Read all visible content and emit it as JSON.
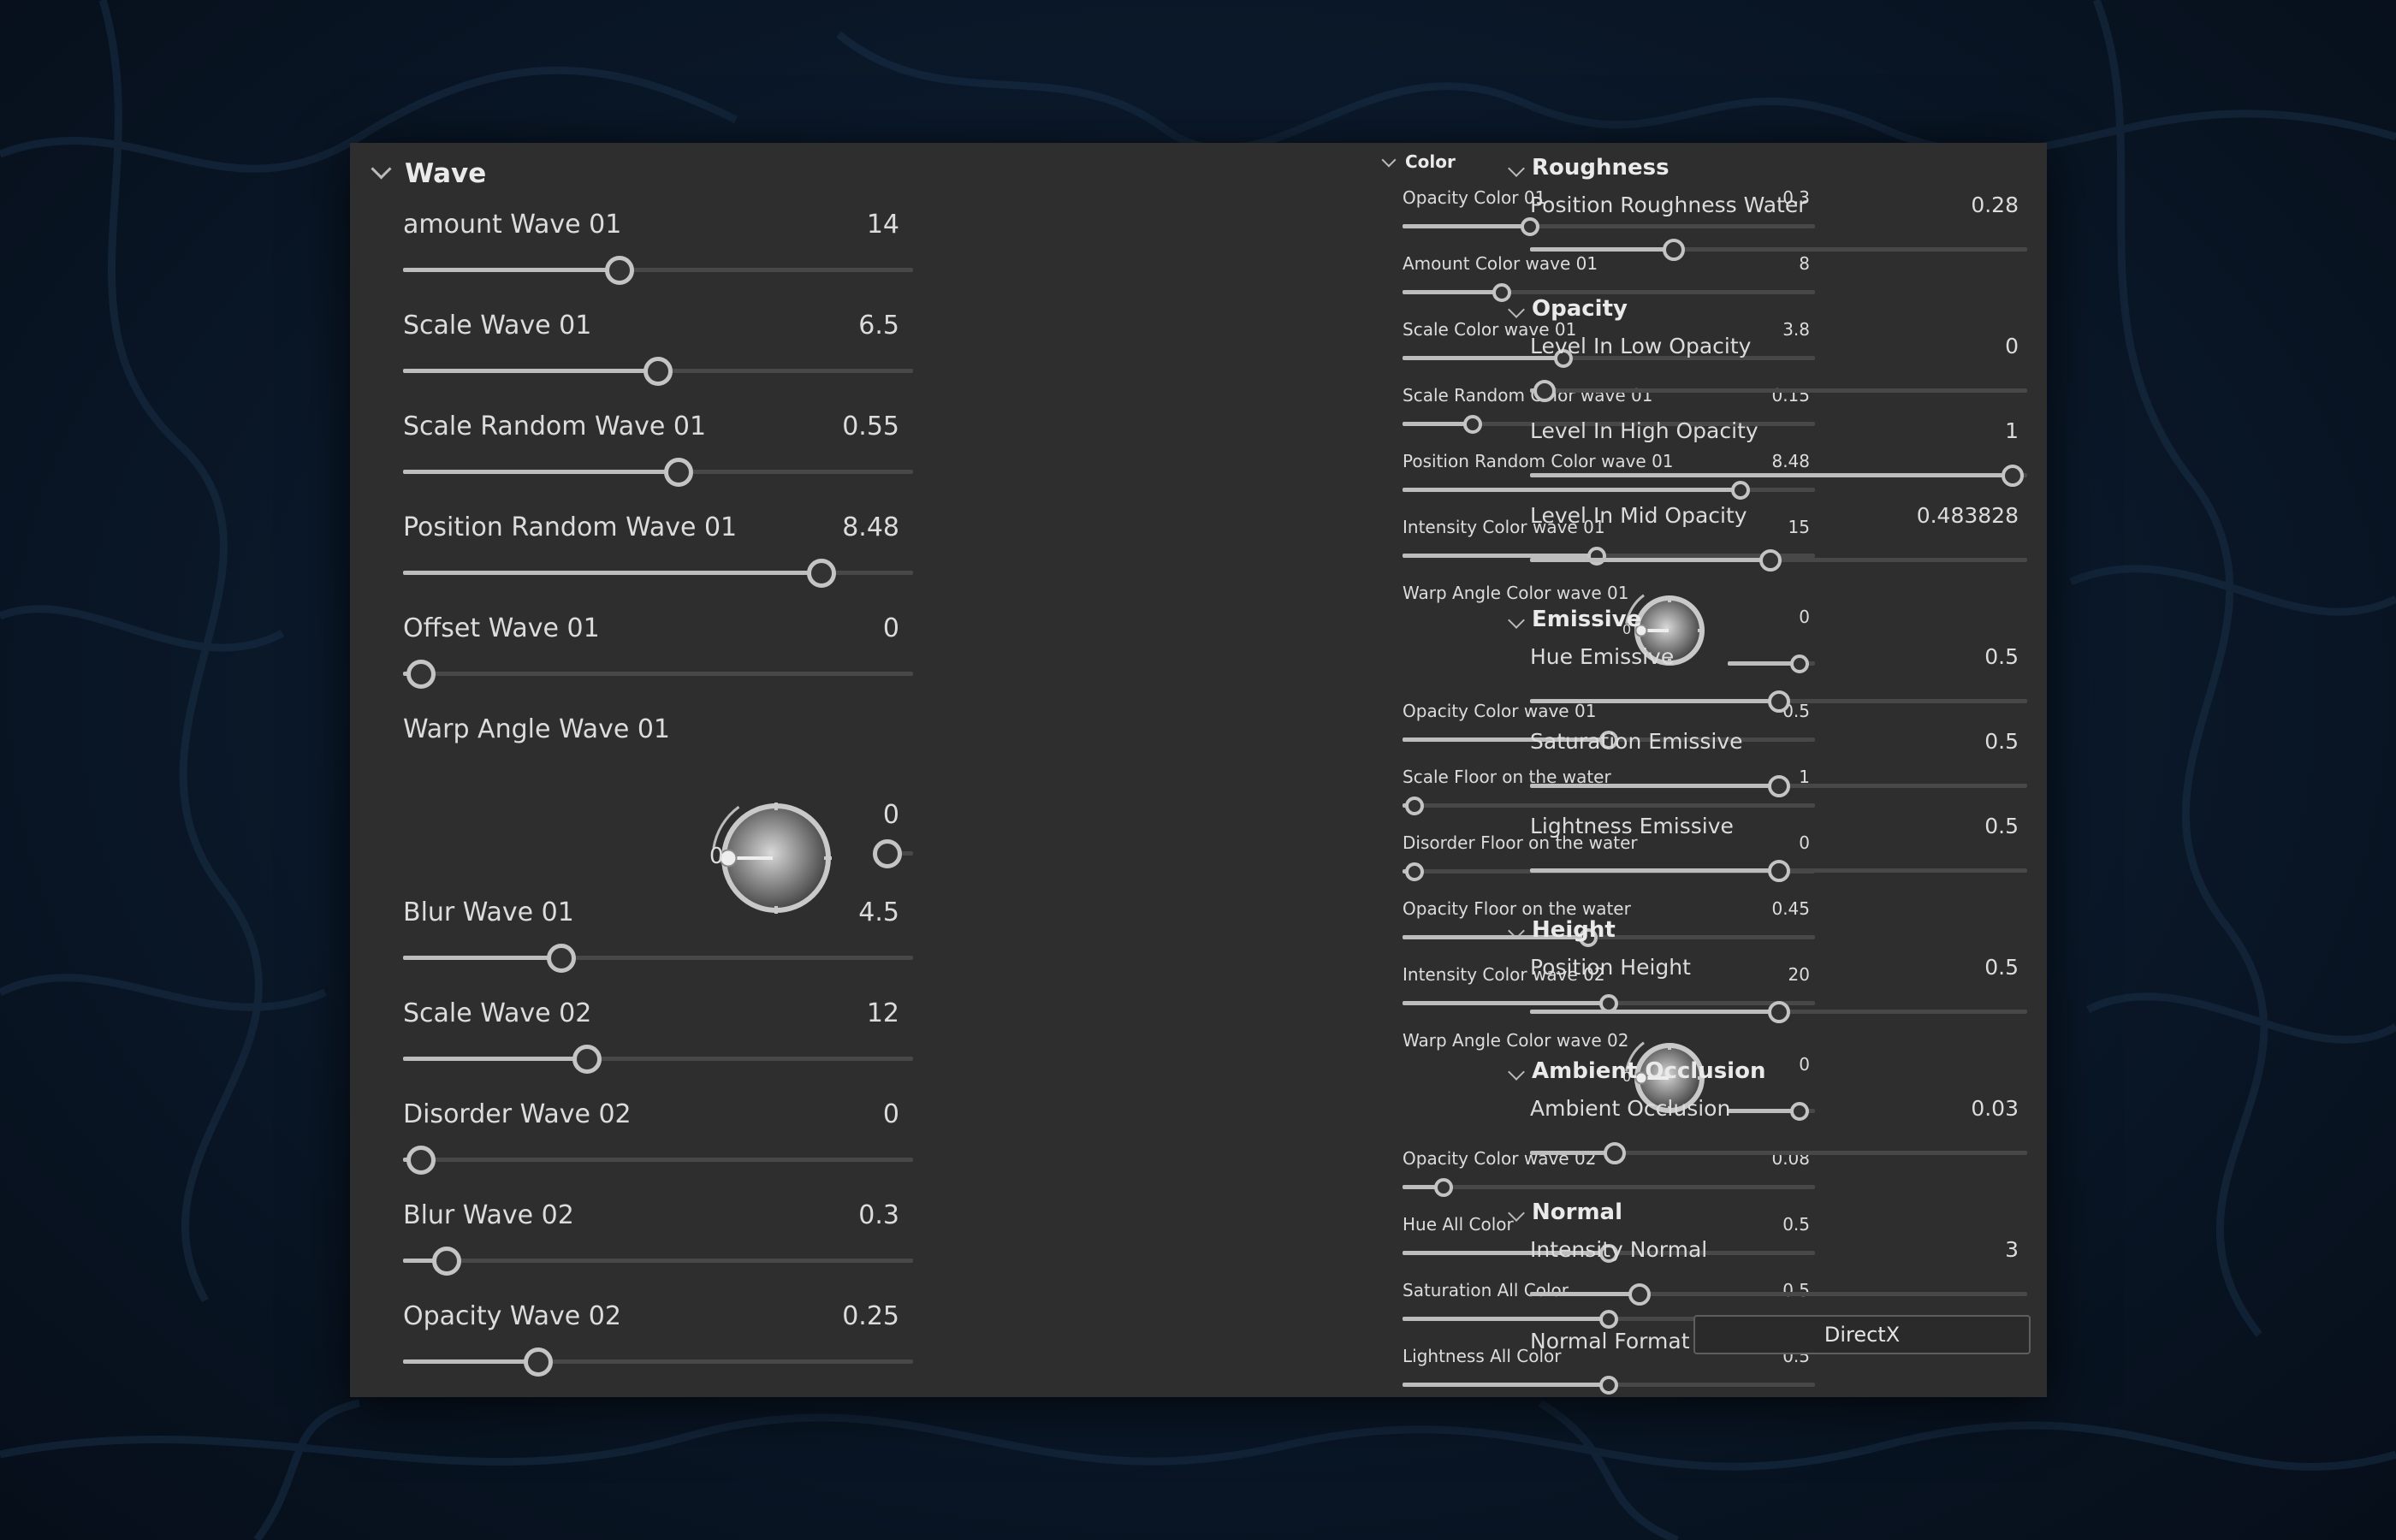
{
  "wave": {
    "title": "Wave",
    "params": [
      {
        "label": "amount Wave 01",
        "value": "14",
        "fraction": 0.425
      },
      {
        "label": "Scale Wave 01",
        "value": "6.5",
        "fraction": 0.5
      },
      {
        "label": "Scale Random Wave 01",
        "value": "0.55",
        "fraction": 0.54
      },
      {
        "label": "Position Random Wave 01",
        "value": "8.48",
        "fraction": 0.82
      },
      {
        "label": "Offset Wave 01",
        "value": "0",
        "fraction": 0.035
      },
      {
        "label": "Warp Angle Wave 01",
        "value": "0",
        "fraction": 0.35,
        "knob": true,
        "knob_zero": "0"
      },
      {
        "label": "Blur Wave 01",
        "value": "4.5",
        "fraction": 0.31
      },
      {
        "label": "Scale Wave 02",
        "value": "12",
        "fraction": 0.36
      },
      {
        "label": "Disorder Wave 02",
        "value": "0",
        "fraction": 0.035
      },
      {
        "label": "Blur Wave 02",
        "value": "0.3",
        "fraction": 0.085
      },
      {
        "label": "Opacity Wave 02",
        "value": "0.25",
        "fraction": 0.265
      }
    ]
  },
  "color": {
    "title": "Color",
    "params": [
      {
        "label": "Opacity Color 01",
        "value": "0.3",
        "fraction": 0.31
      },
      {
        "label": "Amount Color wave 01",
        "value": "8",
        "fraction": 0.24
      },
      {
        "label": "Scale Color wave 01",
        "value": "3.8",
        "fraction": 0.39
      },
      {
        "label": "Scale Random Color wave 01",
        "value": "0.15",
        "fraction": 0.17
      },
      {
        "label": "Position Random Color wave 01",
        "value": "8.48",
        "fraction": 0.82
      },
      {
        "label": "Intensity Color wave 01",
        "value": "15",
        "fraction": 0.47
      },
      {
        "label": "Warp Angle Color wave 01",
        "value": "0",
        "fraction": 0.82,
        "knob": true,
        "knob_zero": "0"
      },
      {
        "label": "Opacity Color wave 01",
        "value": "0.5",
        "fraction": 0.5
      },
      {
        "label": "Scale Floor on the water",
        "value": "1",
        "fraction": 0.03
      },
      {
        "label": "Disorder Floor on the water",
        "value": "0",
        "fraction": 0.03
      },
      {
        "label": "Opacity Floor on the water",
        "value": "0.45",
        "fraction": 0.45
      },
      {
        "label": "Intensity Color wave 02",
        "value": "20",
        "fraction": 0.5
      },
      {
        "label": "Warp Angle Color wave 02",
        "value": "0",
        "fraction": 0.82,
        "knob": true,
        "knob_zero": "0"
      },
      {
        "label": "Opacity Color wave 02",
        "value": "0.08",
        "fraction": 0.1
      },
      {
        "label": "Hue All Color",
        "value": "0.5",
        "fraction": 0.5
      },
      {
        "label": "Saturation All Color",
        "value": "0.5",
        "fraction": 0.5
      },
      {
        "label": "Lightness All Color",
        "value": "0.5",
        "fraction": 0.5
      }
    ]
  },
  "right": {
    "sections": [
      {
        "title": "Roughness",
        "params": [
          {
            "label": "Position Roughness Water",
            "value": "0.28",
            "fraction": 0.29
          }
        ]
      },
      {
        "title": "Opacity",
        "params": [
          {
            "label": "Level In Low Opacity",
            "value": "0",
            "fraction": 0.03
          },
          {
            "label": "Level In High Opacity",
            "value": "1",
            "fraction": 0.97
          },
          {
            "label": "Level In Mid Opacity",
            "value": "0.483828",
            "fraction": 0.483828
          }
        ]
      },
      {
        "title": "Emissive",
        "params": [
          {
            "label": "Hue Emissive",
            "value": "0.5",
            "fraction": 0.5
          },
          {
            "label": "Saturation Emissive",
            "value": "0.5",
            "fraction": 0.5
          },
          {
            "label": "Lightness Emissive",
            "value": "0.5",
            "fraction": 0.5
          }
        ]
      },
      {
        "title": "Height",
        "params": [
          {
            "label": "Position Height",
            "value": "0.5",
            "fraction": 0.5
          }
        ]
      },
      {
        "title": "Ambient Occlusion",
        "params": [
          {
            "label": "Ambient Occlusion",
            "value": "0.03",
            "fraction": 0.17
          }
        ]
      },
      {
        "title": "Normal",
        "params": [
          {
            "label": "Intensity Normal",
            "value": "3",
            "fraction": 0.22
          }
        ]
      }
    ],
    "normal_format": {
      "label": "Normal Format",
      "value": "DirectX"
    }
  },
  "colors": {
    "panel": "#2e2e2e",
    "track": "#484848",
    "fill": "#bdbdbd",
    "thumb": "#c4c4c4"
  }
}
